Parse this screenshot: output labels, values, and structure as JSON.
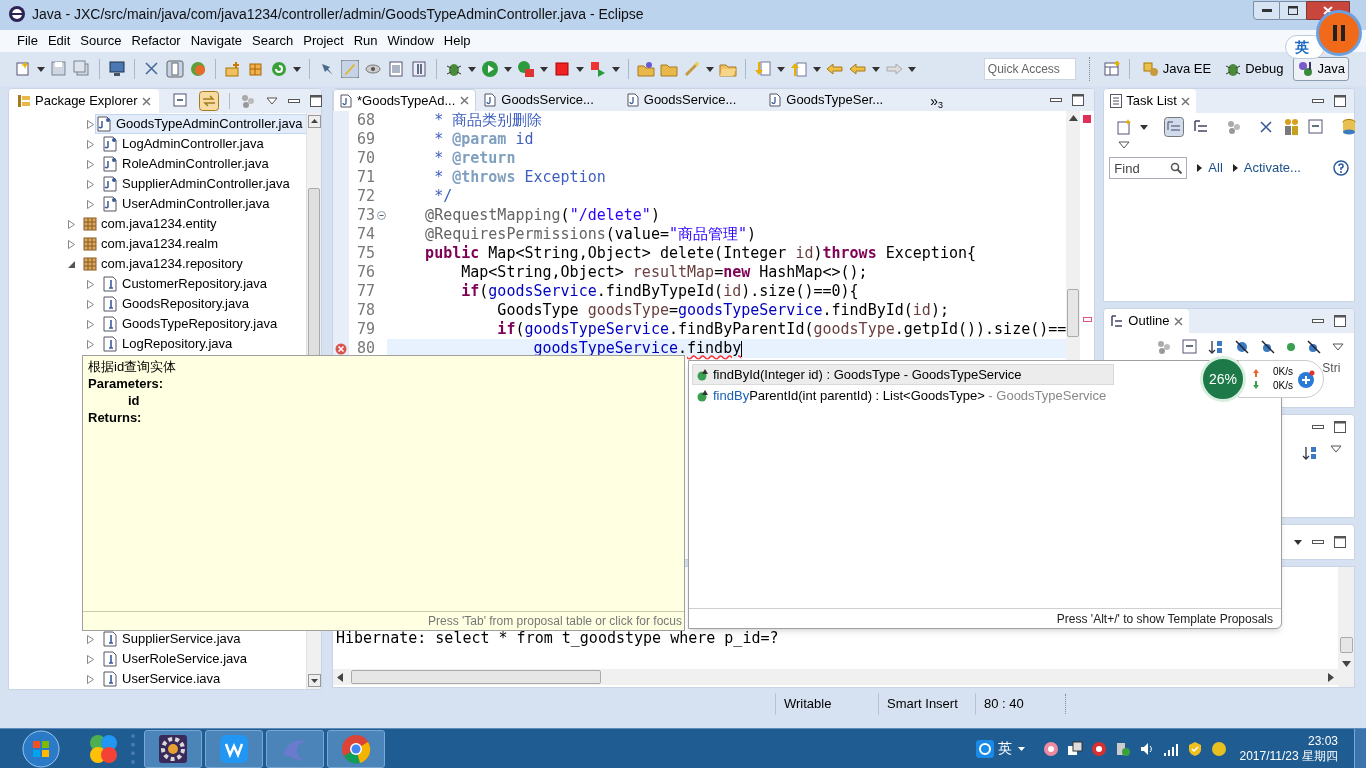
{
  "window": {
    "title": "Java - JXC/src/main/java/com/java1234/controller/admin/GoodsTypeAdminController.java - Eclipse"
  },
  "menu": [
    "File",
    "Edit",
    "Source",
    "Refactor",
    "Navigate",
    "Search",
    "Project",
    "Run",
    "Window",
    "Help"
  ],
  "quick_access": {
    "placeholder": "Quick Access"
  },
  "perspectives": [
    {
      "label": "Java EE",
      "selected": false
    },
    {
      "label": "Debug",
      "selected": false
    },
    {
      "label": "Java",
      "selected": true
    }
  ],
  "ime_bubble": "英",
  "package_explorer": {
    "title": "Package Explorer",
    "tree": [
      {
        "children": [
          {
            "label": "GoodsTypeAdminController.java",
            "kind": "class",
            "expanded": false,
            "selected": true
          },
          {
            "label": "LogAdminController.java",
            "kind": "class",
            "expanded": false,
            "selected": false
          },
          {
            "label": "RoleAdminController.java",
            "kind": "class",
            "expanded": false,
            "selected": false
          },
          {
            "label": "SupplierAdminController.java",
            "kind": "class",
            "expanded": false,
            "selected": false
          },
          {
            "label": "UserAdminController.java",
            "kind": "class",
            "expanded": false,
            "selected": false
          }
        ]
      },
      {
        "label": "com.java1234.entity",
        "kind": "package",
        "expanded": false,
        "selected": false
      },
      {
        "label": "com.java1234.realm",
        "kind": "package",
        "expanded": false,
        "selected": false
      },
      {
        "label": "com.java1234.repository",
        "kind": "package",
        "expanded": true,
        "selected": false,
        "children": [
          {
            "label": "CustomerRepository.java",
            "kind": "interface",
            "expanded": false,
            "selected": false
          },
          {
            "label": "GoodsRepository.java",
            "kind": "interface",
            "expanded": false,
            "selected": false
          },
          {
            "label": "GoodsTypeRepository.java",
            "kind": "interface",
            "expanded": false,
            "selected": false
          },
          {
            "label": "LogRepository.java",
            "kind": "interface",
            "expanded": false,
            "selected": false
          }
        ]
      },
      {
        "children": [
          {
            "label": "SupplierService.java",
            "kind": "interface",
            "expanded": false,
            "selected": false
          },
          {
            "label": "UserRoleService.java",
            "kind": "interface",
            "expanded": false,
            "selected": false
          },
          {
            "label": "UserService.iava",
            "kind": "interface",
            "expanded": false,
            "selected": false
          }
        ]
      }
    ]
  },
  "editor": {
    "tabs": [
      {
        "label": "*GoodsTypeAd...",
        "selected": true
      },
      {
        "label": "GoodsService...",
        "selected": false
      },
      {
        "label": "GoodsService...",
        "selected": false
      },
      {
        "label": "GoodsTypeSer...",
        "selected": false
      }
    ],
    "overflow": {
      "symbol": "»",
      "count": "3"
    },
    "lines": [
      {
        "number": "68",
        "error": false,
        "current": false,
        "fold": false,
        "tokens": [
          {
            "kind": "comment",
            "text": "     * 商品类别删除"
          }
        ]
      },
      {
        "number": "69",
        "error": false,
        "current": false,
        "fold": false,
        "tokens": [
          {
            "kind": "comment",
            "text": "     * "
          },
          {
            "kind": "tag",
            "text": "@param"
          },
          {
            "kind": "comment",
            "text": " id"
          }
        ]
      },
      {
        "number": "70",
        "error": false,
        "current": false,
        "fold": false,
        "tokens": [
          {
            "kind": "comment",
            "text": "     * "
          },
          {
            "kind": "tag",
            "text": "@return"
          }
        ]
      },
      {
        "number": "71",
        "error": false,
        "current": false,
        "fold": false,
        "tokens": [
          {
            "kind": "comment",
            "text": "     * "
          },
          {
            "kind": "tag",
            "text": "@throws"
          },
          {
            "kind": "comment",
            "text": " Exception"
          }
        ]
      },
      {
        "number": "72",
        "error": false,
        "current": false,
        "fold": false,
        "tokens": [
          {
            "kind": "comment",
            "text": "     */"
          }
        ]
      },
      {
        "number": "73",
        "error": false,
        "current": false,
        "fold": true,
        "tokens": [
          {
            "kind": "annotation",
            "text": "    @RequestMapping"
          },
          {
            "kind": "plain",
            "text": "("
          },
          {
            "kind": "string",
            "text": "\"/delete\""
          },
          {
            "kind": "plain",
            "text": ")"
          }
        ]
      },
      {
        "number": "74",
        "error": false,
        "current": false,
        "fold": false,
        "tokens": [
          {
            "kind": "annotation",
            "text": "    @RequiresPermissions"
          },
          {
            "kind": "plain",
            "text": "(value="
          },
          {
            "kind": "string",
            "text": "\"商品管理\""
          },
          {
            "kind": "plain",
            "text": ")"
          }
        ]
      },
      {
        "number": "75",
        "error": false,
        "current": false,
        "fold": false,
        "tokens": [
          {
            "kind": "keyword",
            "text": "    public"
          },
          {
            "kind": "plain",
            "text": " Map<String,Object> delete(Integer "
          },
          {
            "kind": "local",
            "text": "id"
          },
          {
            "kind": "plain",
            "text": ")"
          },
          {
            "kind": "keyword",
            "text": "throws"
          },
          {
            "kind": "plain",
            "text": " Exception{"
          }
        ]
      },
      {
        "number": "76",
        "error": false,
        "current": false,
        "fold": false,
        "tokens": [
          {
            "kind": "plain",
            "text": "        Map<String,Object> "
          },
          {
            "kind": "local",
            "text": "resultMap"
          },
          {
            "kind": "plain",
            "text": "="
          },
          {
            "kind": "keyword",
            "text": "new"
          },
          {
            "kind": "plain",
            "text": " HashMap<>();"
          }
        ]
      },
      {
        "number": "77",
        "error": false,
        "current": false,
        "fold": false,
        "tokens": [
          {
            "kind": "keyword",
            "text": "        if"
          },
          {
            "kind": "plain",
            "text": "("
          },
          {
            "kind": "field",
            "text": "goodsService"
          },
          {
            "kind": "plain",
            "text": ".findByTypeId("
          },
          {
            "kind": "local",
            "text": "id"
          },
          {
            "kind": "plain",
            "text": ").size()==0){"
          }
        ]
      },
      {
        "number": "78",
        "error": false,
        "current": false,
        "fold": false,
        "tokens": [
          {
            "kind": "plain",
            "text": "            GoodsType "
          },
          {
            "kind": "local",
            "text": "goodsType"
          },
          {
            "kind": "plain",
            "text": "="
          },
          {
            "kind": "field",
            "text": "goodsTypeService"
          },
          {
            "kind": "plain",
            "text": ".findById("
          },
          {
            "kind": "local",
            "text": "id"
          },
          {
            "kind": "plain",
            "text": ");"
          }
        ]
      },
      {
        "number": "79",
        "error": false,
        "current": false,
        "fold": false,
        "tokens": [
          {
            "kind": "keyword",
            "text": "            if"
          },
          {
            "kind": "plain",
            "text": "("
          },
          {
            "kind": "field",
            "text": "goodsTypeService"
          },
          {
            "kind": "plain",
            "text": ".findByParentId("
          },
          {
            "kind": "local",
            "text": "goodsType"
          },
          {
            "kind": "plain",
            "text": ".getpId()).size()=="
          }
        ]
      },
      {
        "number": "80",
        "error": true,
        "current": true,
        "fold": false,
        "tokens": [
          {
            "kind": "field",
            "text": "                goodsTypeService"
          },
          {
            "kind": "plain",
            "text": "."
          },
          {
            "kind": "misspelled",
            "text": "findby"
          }
        ]
      }
    ]
  },
  "task_list": {
    "title": "Task List",
    "find": {
      "placeholder": "Find"
    },
    "links": [
      "All",
      "Activate..."
    ]
  },
  "outline": {
    "title": "Outline",
    "text": "Stri"
  },
  "console": {
    "line": "Hibernate: select * from t_goodstype where p_id=?"
  },
  "javadoc": {
    "summary": "根据id查询实体",
    "sections": [
      {
        "heading": "Parameters:",
        "items": [
          "id"
        ]
      },
      {
        "heading": "Returns:"
      }
    ],
    "footer": "Press 'Tab' from proposal table or click for focus"
  },
  "proposals": {
    "items": [
      {
        "selected": true,
        "segments": [
          {
            "kind": "plain",
            "text": "findById(Integer id) : GoodsType - GoodsTypeService"
          }
        ]
      },
      {
        "selected": false,
        "segments": [
          {
            "kind": "match",
            "text": "findBy"
          },
          {
            "kind": "plain",
            "text": "ParentId(int parentId) : List<GoodsType>"
          },
          {
            "kind": "qualifier",
            "text": " - GoodsTypeService"
          }
        ]
      }
    ],
    "footer": "Press 'Alt+/' to show Template Proposals"
  },
  "net_monitor": {
    "percent": "26%",
    "upload": "0K/s",
    "download": "0K/s"
  },
  "status_bar": [
    "Writable",
    "Smart Insert",
    "80 : 40"
  ],
  "tray": {
    "ime": "英",
    "time": "23:03",
    "date": "2017/11/23 星期四"
  }
}
